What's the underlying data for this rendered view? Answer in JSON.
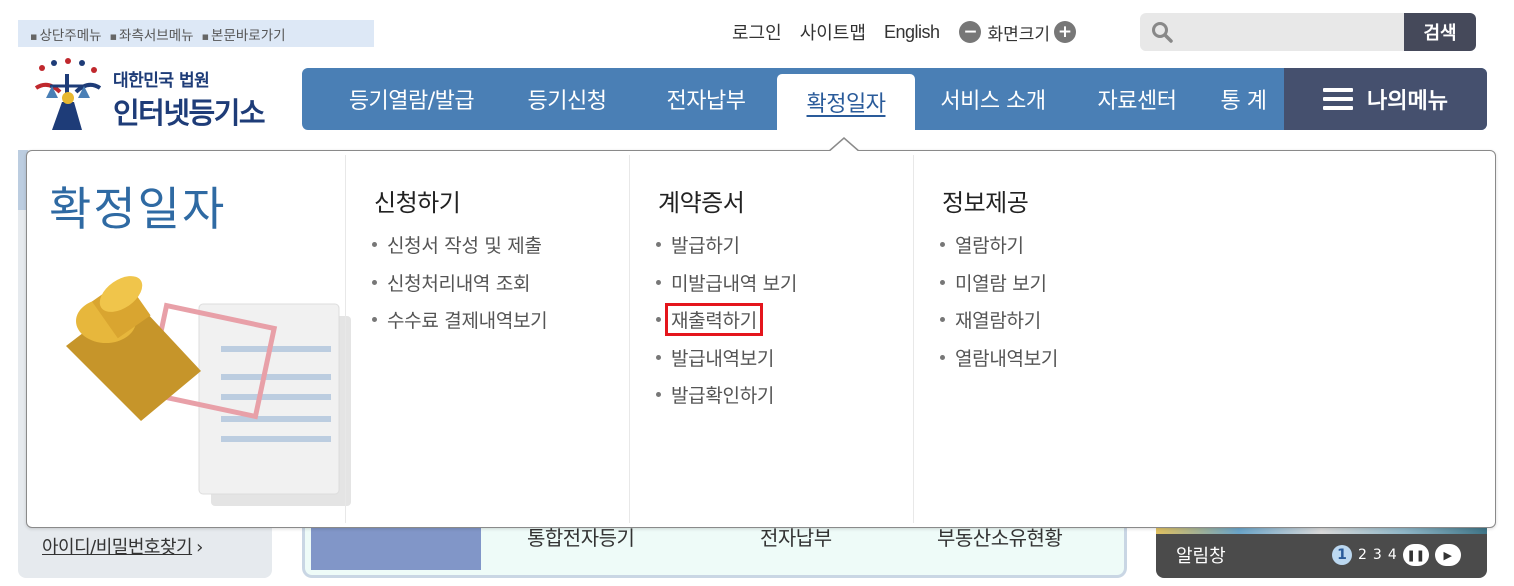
{
  "skip_links": [
    "상단주메뉴",
    "좌측서브메뉴",
    "본문바로가기"
  ],
  "util": {
    "login": "로그인",
    "sitemap": "사이트맵",
    "english": "English",
    "zoom_label": "화면크기",
    "zoom_out": "−",
    "zoom_in": "+"
  },
  "search": {
    "button": "검색",
    "placeholder": ""
  },
  "logo": {
    "small": "대한민국 법원",
    "big": "인터넷등기소"
  },
  "gnb": {
    "items": [
      "등기열람/발급",
      "등기신청",
      "전자납부",
      "확정일자",
      "서비스 소개",
      "자료센터",
      "통 계"
    ],
    "active": "확정일자",
    "my_menu": "나의메뉴"
  },
  "dropdown": {
    "title": "확정일자",
    "columns": [
      {
        "heading": "신청하기",
        "items": [
          "신청서 작성 및 제출",
          "신청처리내역 조회",
          "수수료 결제내역보기"
        ]
      },
      {
        "heading": "계약증서",
        "items": [
          "발급하기",
          "미발급내역 보기",
          "재출력하기",
          "발급내역보기",
          "발급확인하기"
        ],
        "highlighted": "재출력하기"
      },
      {
        "heading": "정보제공",
        "items": [
          "열람하기",
          "미열람 보기",
          "재열람하기",
          "열람내역보기"
        ]
      }
    ]
  },
  "background": {
    "find_id": "아이디/비밀번호찾기",
    "mid_labels": [
      "통합전자등기",
      "전자납부",
      "부동산소유현황"
    ],
    "notice": "알림창",
    "pager": [
      "1",
      "2",
      "3",
      "4"
    ]
  },
  "colors": {
    "gnb": "#4a7fb5",
    "mymenu": "#45506e",
    "title": "#2f6aa3",
    "highlight": "#e4151c"
  }
}
